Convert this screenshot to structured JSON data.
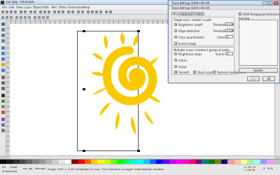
{
  "window": {
    "title": "sun.jpg - Inkscape"
  },
  "menu": [
    "File",
    "Edit",
    "View",
    "Layer",
    "Object",
    "Path",
    "Text",
    "Filters",
    "Extensions",
    "Help"
  ],
  "dialog": {
    "title": "Trace Bitmap (Shift+Alt+B)",
    "subtitle": "Trace Bitmap (Shift+Alt+B)",
    "panel_title": "Trace Bitmap (Shift+Alt+B)",
    "tabs": [
      "Mode",
      "Options",
      "Credits"
    ],
    "single_scan_title": "Single scan: creates a path",
    "brightness_cutoff": {
      "label": "Brightness cutoff",
      "threshold_label": "Threshold:",
      "value": "0.450"
    },
    "edge_detection": {
      "label": "Edge detection",
      "threshold_label": "Threshold:",
      "value": "0.650"
    },
    "color_quantization": {
      "label": "Color quantization",
      "colors_label": "Colors:",
      "value": "8"
    },
    "invert_image": "Invert image",
    "multiple_scans_title": "Multiple scans: creates a group of paths",
    "brightness_steps": {
      "label": "Brightness steps",
      "scans_label": "Scans:",
      "value": "8"
    },
    "colors": "Colors",
    "grays": "Grays",
    "smooth": "Smooth",
    "stack_scans": "Stack scans",
    "remove_background": "Remove background",
    "sioh_label": "SIOX foreground selection",
    "preview_label": "Preview",
    "update_button": "Update",
    "stop_button": "Stop",
    "ok_button": "OK"
  },
  "status": {
    "fill_label": "Fill:",
    "fill_value": "Unset",
    "stroke_label": "Stroke:",
    "stroke_value": "Unset",
    "layer": "sun.jpg - Inkscape",
    "message": "Image 1195 × 1195: embedded in root. Click selection to toggle scale/rotation handles.",
    "x_label": "X:",
    "x_value": "697.32",
    "y_label": "Y:",
    "y_value": "250.62",
    "zoom_label": "Z:",
    "zoom_value": "35%"
  },
  "colors": {
    "sun": "#f9c900",
    "canvas": "#ffffff",
    "desktop": "#c9c9c9"
  },
  "palette": [
    "#000000",
    "#1a1a1a",
    "#333333",
    "#4d4d4d",
    "#666666",
    "#808080",
    "#999999",
    "#b3b3b3",
    "#cccccc",
    "#e6e6e6",
    "#ffffff",
    "#800000",
    "#ff0000",
    "#ff6600",
    "#ffcc00",
    "#ffff00",
    "#ccff00",
    "#66ff00",
    "#00ff00",
    "#00ff66",
    "#00ffcc",
    "#00ffff",
    "#00ccff",
    "#0066ff",
    "#0000ff",
    "#6600ff",
    "#cc00ff",
    "#ff00ff",
    "#ff00cc",
    "#ff0066",
    "#800080",
    "#008080",
    "#008000",
    "#808000",
    "#000080",
    "#ff9999",
    "#ffcc99",
    "#ffff99",
    "#99ff99",
    "#99ffff",
    "#9999ff",
    "#ff99ff",
    "#c0c0c0"
  ]
}
